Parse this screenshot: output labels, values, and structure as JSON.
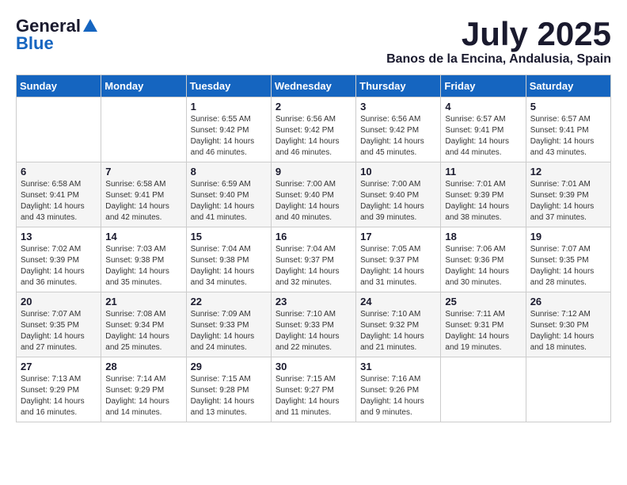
{
  "logo": {
    "general": "General",
    "blue": "Blue"
  },
  "title": {
    "month_year": "July 2025",
    "location": "Banos de la Encina, Andalusia, Spain"
  },
  "days_of_week": [
    "Sunday",
    "Monday",
    "Tuesday",
    "Wednesday",
    "Thursday",
    "Friday",
    "Saturday"
  ],
  "weeks": [
    [
      {
        "day": "",
        "info": ""
      },
      {
        "day": "",
        "info": ""
      },
      {
        "day": "1",
        "info": "Sunrise: 6:55 AM\nSunset: 9:42 PM\nDaylight: 14 hours and 46 minutes."
      },
      {
        "day": "2",
        "info": "Sunrise: 6:56 AM\nSunset: 9:42 PM\nDaylight: 14 hours and 46 minutes."
      },
      {
        "day": "3",
        "info": "Sunrise: 6:56 AM\nSunset: 9:42 PM\nDaylight: 14 hours and 45 minutes."
      },
      {
        "day": "4",
        "info": "Sunrise: 6:57 AM\nSunset: 9:41 PM\nDaylight: 14 hours and 44 minutes."
      },
      {
        "day": "5",
        "info": "Sunrise: 6:57 AM\nSunset: 9:41 PM\nDaylight: 14 hours and 43 minutes."
      }
    ],
    [
      {
        "day": "6",
        "info": "Sunrise: 6:58 AM\nSunset: 9:41 PM\nDaylight: 14 hours and 43 minutes."
      },
      {
        "day": "7",
        "info": "Sunrise: 6:58 AM\nSunset: 9:41 PM\nDaylight: 14 hours and 42 minutes."
      },
      {
        "day": "8",
        "info": "Sunrise: 6:59 AM\nSunset: 9:40 PM\nDaylight: 14 hours and 41 minutes."
      },
      {
        "day": "9",
        "info": "Sunrise: 7:00 AM\nSunset: 9:40 PM\nDaylight: 14 hours and 40 minutes."
      },
      {
        "day": "10",
        "info": "Sunrise: 7:00 AM\nSunset: 9:40 PM\nDaylight: 14 hours and 39 minutes."
      },
      {
        "day": "11",
        "info": "Sunrise: 7:01 AM\nSunset: 9:39 PM\nDaylight: 14 hours and 38 minutes."
      },
      {
        "day": "12",
        "info": "Sunrise: 7:01 AM\nSunset: 9:39 PM\nDaylight: 14 hours and 37 minutes."
      }
    ],
    [
      {
        "day": "13",
        "info": "Sunrise: 7:02 AM\nSunset: 9:39 PM\nDaylight: 14 hours and 36 minutes."
      },
      {
        "day": "14",
        "info": "Sunrise: 7:03 AM\nSunset: 9:38 PM\nDaylight: 14 hours and 35 minutes."
      },
      {
        "day": "15",
        "info": "Sunrise: 7:04 AM\nSunset: 9:38 PM\nDaylight: 14 hours and 34 minutes."
      },
      {
        "day": "16",
        "info": "Sunrise: 7:04 AM\nSunset: 9:37 PM\nDaylight: 14 hours and 32 minutes."
      },
      {
        "day": "17",
        "info": "Sunrise: 7:05 AM\nSunset: 9:37 PM\nDaylight: 14 hours and 31 minutes."
      },
      {
        "day": "18",
        "info": "Sunrise: 7:06 AM\nSunset: 9:36 PM\nDaylight: 14 hours and 30 minutes."
      },
      {
        "day": "19",
        "info": "Sunrise: 7:07 AM\nSunset: 9:35 PM\nDaylight: 14 hours and 28 minutes."
      }
    ],
    [
      {
        "day": "20",
        "info": "Sunrise: 7:07 AM\nSunset: 9:35 PM\nDaylight: 14 hours and 27 minutes."
      },
      {
        "day": "21",
        "info": "Sunrise: 7:08 AM\nSunset: 9:34 PM\nDaylight: 14 hours and 25 minutes."
      },
      {
        "day": "22",
        "info": "Sunrise: 7:09 AM\nSunset: 9:33 PM\nDaylight: 14 hours and 24 minutes."
      },
      {
        "day": "23",
        "info": "Sunrise: 7:10 AM\nSunset: 9:33 PM\nDaylight: 14 hours and 22 minutes."
      },
      {
        "day": "24",
        "info": "Sunrise: 7:10 AM\nSunset: 9:32 PM\nDaylight: 14 hours and 21 minutes."
      },
      {
        "day": "25",
        "info": "Sunrise: 7:11 AM\nSunset: 9:31 PM\nDaylight: 14 hours and 19 minutes."
      },
      {
        "day": "26",
        "info": "Sunrise: 7:12 AM\nSunset: 9:30 PM\nDaylight: 14 hours and 18 minutes."
      }
    ],
    [
      {
        "day": "27",
        "info": "Sunrise: 7:13 AM\nSunset: 9:29 PM\nDaylight: 14 hours and 16 minutes."
      },
      {
        "day": "28",
        "info": "Sunrise: 7:14 AM\nSunset: 9:29 PM\nDaylight: 14 hours and 14 minutes."
      },
      {
        "day": "29",
        "info": "Sunrise: 7:15 AM\nSunset: 9:28 PM\nDaylight: 14 hours and 13 minutes."
      },
      {
        "day": "30",
        "info": "Sunrise: 7:15 AM\nSunset: 9:27 PM\nDaylight: 14 hours and 11 minutes."
      },
      {
        "day": "31",
        "info": "Sunrise: 7:16 AM\nSunset: 9:26 PM\nDaylight: 14 hours and 9 minutes."
      },
      {
        "day": "",
        "info": ""
      },
      {
        "day": "",
        "info": ""
      }
    ]
  ]
}
